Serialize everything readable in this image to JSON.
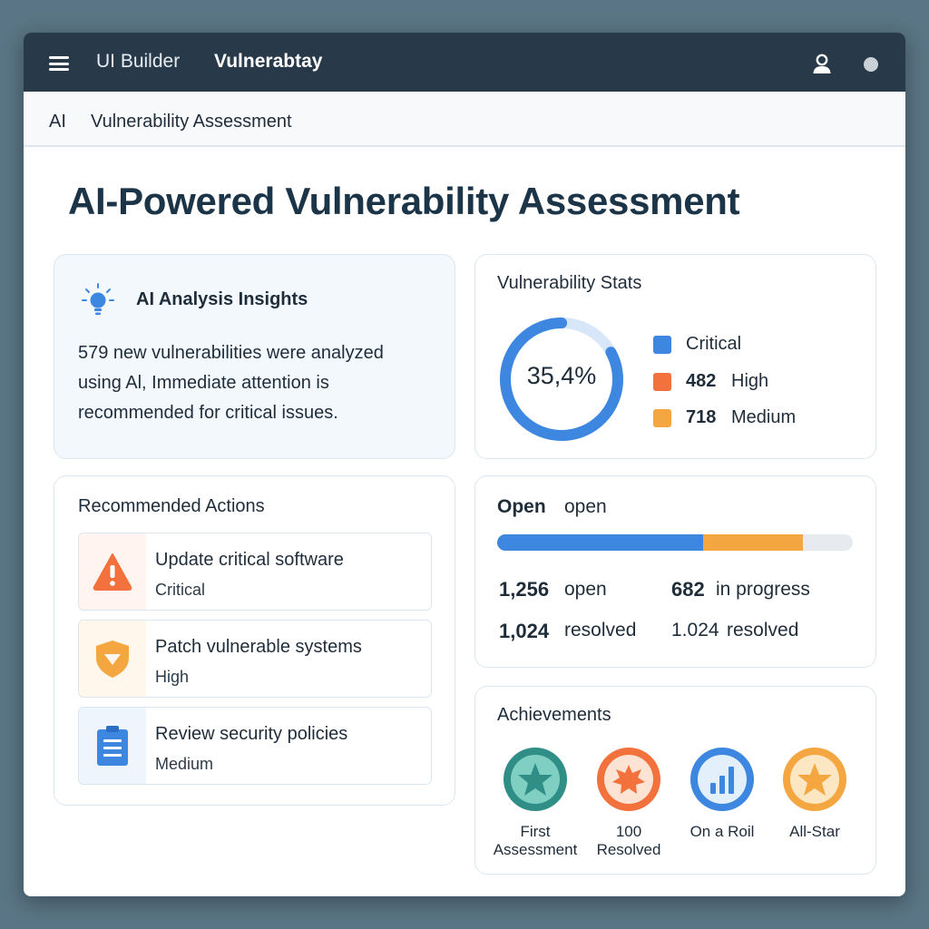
{
  "topbar": {
    "menu_icon": "hamburger-menu-icon",
    "app_name": "UI Builder",
    "title": "Vulnerabtay",
    "user_icon": "user-icon",
    "status_icon": "status-dot-icon"
  },
  "breadcrumb": {
    "items": [
      "AI",
      "Vulnerability Assessment"
    ]
  },
  "page": {
    "title": "AI-Powered Vulnerability Assessment"
  },
  "insights": {
    "icon": "lightbulb-icon",
    "title": "AI Analysis Insights",
    "lines": [
      "579 new vulnerabilities were analyzed",
      "using Al, Immediate attention is",
      "recommended for critical issues."
    ]
  },
  "stats": {
    "title": "Vulnerability Stats",
    "donut_percent": 0.83,
    "donut_label": "35,4%",
    "legend": [
      {
        "count": "",
        "name": "Critical",
        "color": "#3d87e0"
      },
      {
        "count": "482",
        "name": "High",
        "color": "#f2713c"
      },
      {
        "count": "718",
        "name": "Medium",
        "color": "#f4a640"
      }
    ]
  },
  "actions": {
    "title": "Recommended Actions",
    "items": [
      {
        "title": "Update critical software",
        "priority": "Critical",
        "icon": "warning-triangle-icon",
        "color": "#f2713c",
        "bg": "#fff4f0"
      },
      {
        "title": "Patch vulnerable systems",
        "priority": "High",
        "icon": "shield-icon",
        "color": "#f4a640",
        "bg": "#fff7eb"
      },
      {
        "title": "Review security policies",
        "priority": "Medium",
        "icon": "clipboard-icon",
        "color": "#3d87e0",
        "bg": "#eef5fd"
      }
    ]
  },
  "progress": {
    "title": "Open",
    "subtitle": "open",
    "segments": [
      {
        "fraction": 0.58,
        "color": "#3d87e0"
      },
      {
        "fraction": 0.28,
        "color": "#f4a640"
      }
    ],
    "stats": [
      {
        "num": "1,256",
        "label": "open"
      },
      {
        "num": "682",
        "label": "in progress"
      },
      {
        "num": "1,024",
        "label": "resolved"
      },
      {
        "num": "1.024",
        "label": "resolved"
      }
    ]
  },
  "achievements": {
    "title": "Achievements",
    "badges": [
      {
        "label_1": "First",
        "label_2": "Assessment",
        "icon": "star-badge-icon",
        "ring": "#2f8f86",
        "fill": "#7fcfc2"
      },
      {
        "label_1": "100",
        "label_2": "Resolved",
        "icon": "burst-badge-icon",
        "ring": "#f2713c",
        "fill": "#fde3d3"
      },
      {
        "label_1": "On a Roil",
        "label_2": "",
        "icon": "bar-chart-badge-icon",
        "ring": "#3d87e0",
        "fill": "#e4effc"
      },
      {
        "label_1": "All-Star",
        "label_2": "",
        "icon": "star-badge-icon",
        "ring": "#f4a640",
        "fill": "#fde6c2"
      }
    ]
  }
}
